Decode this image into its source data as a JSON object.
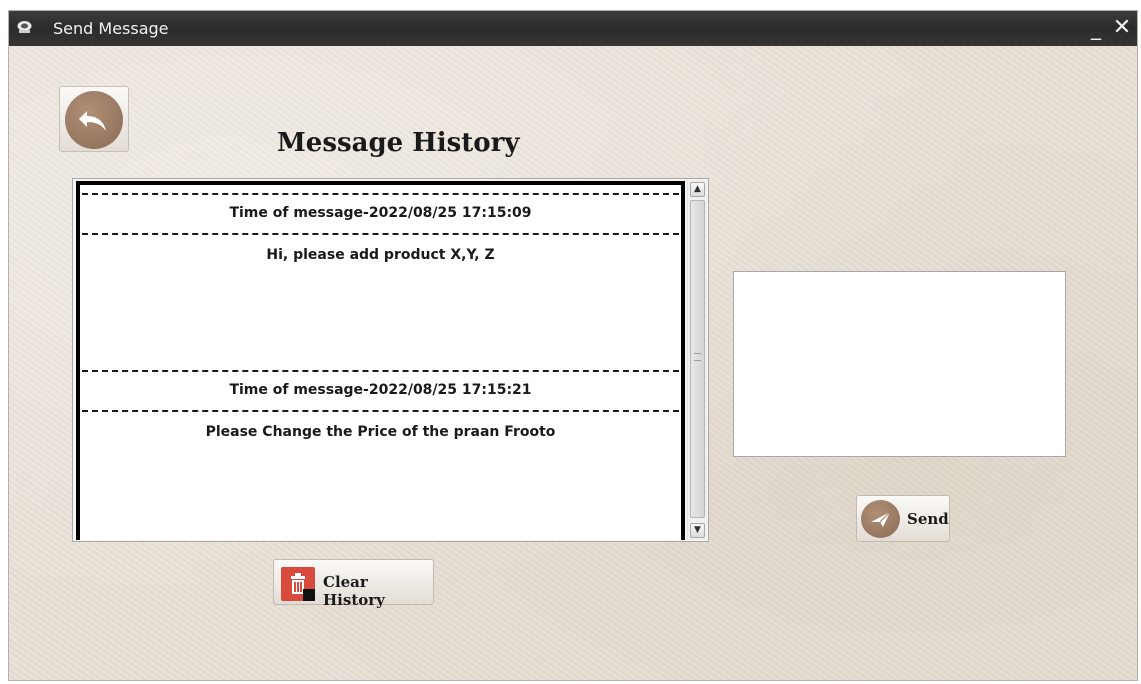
{
  "window": {
    "title": "Send Message",
    "minimize_label": "_",
    "close_label": "✕"
  },
  "heading": "Message History",
  "history": {
    "messages": [
      {
        "time": "Time of message-2022/08/25 17:15:09",
        "text": "Hi, please add product X,Y, Z"
      },
      {
        "time": "Time of message-2022/08/25 17:15:21",
        "text": "Please Change the Price of the praan Frooto"
      }
    ]
  },
  "scroll": {
    "up_glyph": "▲",
    "down_glyph": "▼"
  },
  "buttons": {
    "clear_label": "Clear History",
    "send_label": "Send"
  },
  "message_input": {
    "value": ""
  },
  "icons": {
    "app": "app-icon",
    "back": "back-arrow-icon",
    "trash": "trash-icon",
    "send": "paper-plane-icon"
  },
  "colors": {
    "titlebar": "#2b2b2b",
    "background": "#e8e0d6",
    "icon_brown": "#8a6b55",
    "trash_red": "#d84a3b"
  }
}
